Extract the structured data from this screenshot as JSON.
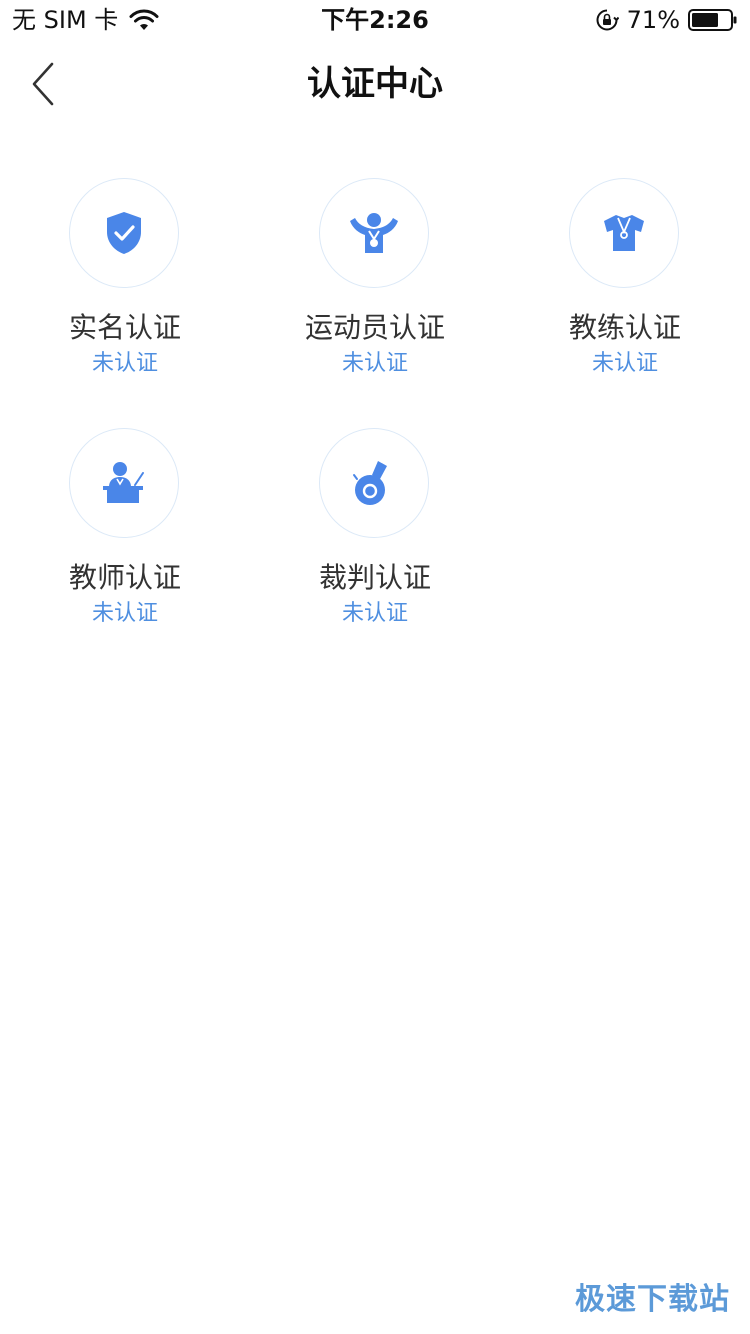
{
  "status_bar": {
    "carrier": "无 SIM 卡",
    "time": "下午2:26",
    "battery": "71%",
    "battery_level": 0.71
  },
  "nav": {
    "title": "认证中心",
    "back_icon": "chevron-left-icon"
  },
  "colors": {
    "accent": "#4f8fe0",
    "icon_fill": "#4a86e8",
    "circle_border": "#dce9f7"
  },
  "certifications": [
    {
      "label": "实名认证",
      "status": "未认证",
      "icon": "shield-check-icon"
    },
    {
      "label": "运动员认证",
      "status": "未认证",
      "icon": "athlete-icon"
    },
    {
      "label": "教练认证",
      "status": "未认证",
      "icon": "coach-shirt-icon"
    },
    {
      "label": "教师认证",
      "status": "未认证",
      "icon": "teacher-podium-icon"
    },
    {
      "label": "裁判认证",
      "status": "未认证",
      "icon": "whistle-icon"
    }
  ],
  "watermark": "极速下载站"
}
